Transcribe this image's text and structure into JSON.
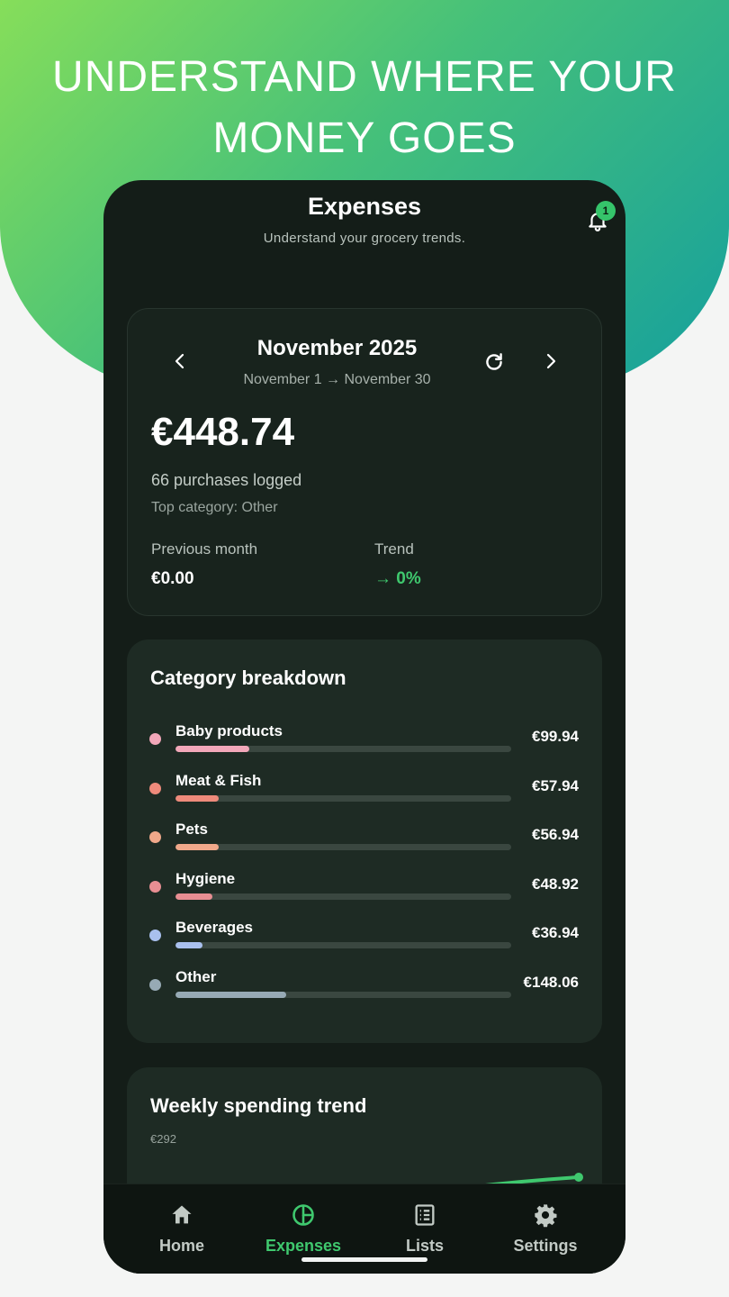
{
  "promo": {
    "line1": "UNDERSTAND WHERE YOUR",
    "line2": "MONEY GOES"
  },
  "colors": {
    "accent": "#3fc86e",
    "background": "#141d18",
    "card": "#1e2b24"
  },
  "header": {
    "title": "Expenses",
    "subtitle": "Understand your grocery trends.",
    "notifications_count": "1"
  },
  "month_card": {
    "title": "November 2025",
    "range": "November 1 → November 30",
    "total": "€448.74",
    "purchases": "66 purchases logged",
    "top_category": "Top category: Other",
    "previous_label": "Previous month",
    "previous_value": "€0.00",
    "trend_label": "Trend",
    "trend_value": "→ 0%"
  },
  "categories": {
    "title": "Category breakdown",
    "items": [
      {
        "name": "Baby products",
        "amount": "€99.94",
        "share": 0.22,
        "color": "#f2a7b9"
      },
      {
        "name": "Meat & Fish",
        "amount": "€57.94",
        "share": 0.13,
        "color": "#ee8a7b"
      },
      {
        "name": "Pets",
        "amount": "€56.94",
        "share": 0.13,
        "color": "#f0a88a"
      },
      {
        "name": "Hygiene",
        "amount": "€48.92",
        "share": 0.11,
        "color": "#e88e92"
      },
      {
        "name": "Beverages",
        "amount": "€36.94",
        "share": 0.08,
        "color": "#a9c0ee"
      },
      {
        "name": "Other",
        "amount": "€148.06",
        "share": 0.33,
        "color": "#97aab5"
      }
    ]
  },
  "weekly": {
    "title": "Weekly spending trend",
    "max_label": "€292"
  },
  "nav": [
    {
      "label": "Home",
      "icon": "home-icon",
      "active": false
    },
    {
      "label": "Expenses",
      "icon": "pie-chart-icon",
      "active": true
    },
    {
      "label": "Lists",
      "icon": "list-icon",
      "active": false
    },
    {
      "label": "Settings",
      "icon": "gear-icon",
      "active": false
    }
  ]
}
